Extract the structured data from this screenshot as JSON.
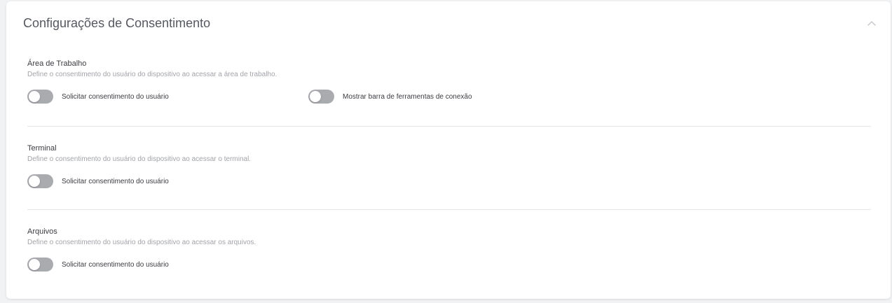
{
  "header": {
    "title": "Configurações de Consentimento",
    "collapse_icon": "chevron-up-icon"
  },
  "sections": [
    {
      "title": "Área de Trabalho",
      "description": "Define o consentimento do usuário do dispositivo ao acessar a área de trabalho.",
      "toggles": [
        {
          "label": "Solicitar consentimento do usuário",
          "enabled": false
        },
        {
          "label": "Mostrar barra de ferramentas de conexão",
          "enabled": false
        }
      ]
    },
    {
      "title": "Terminal",
      "description": "Define o consentimento do usuário do dispositivo ao acessar o terminal.",
      "toggles": [
        {
          "label": "Solicitar consentimento do usuário",
          "enabled": false
        }
      ]
    },
    {
      "title": "Arquivos",
      "description": "Define o consentimento do usuário do dispositivo ao acessar os arquivos.",
      "toggles": [
        {
          "label": "Solicitar consentimento do usuário",
          "enabled": false
        }
      ]
    }
  ],
  "colors": {
    "switch_off": "#a9abaf",
    "card_background": "#ffffff",
    "page_background": "#f1f2f4"
  }
}
